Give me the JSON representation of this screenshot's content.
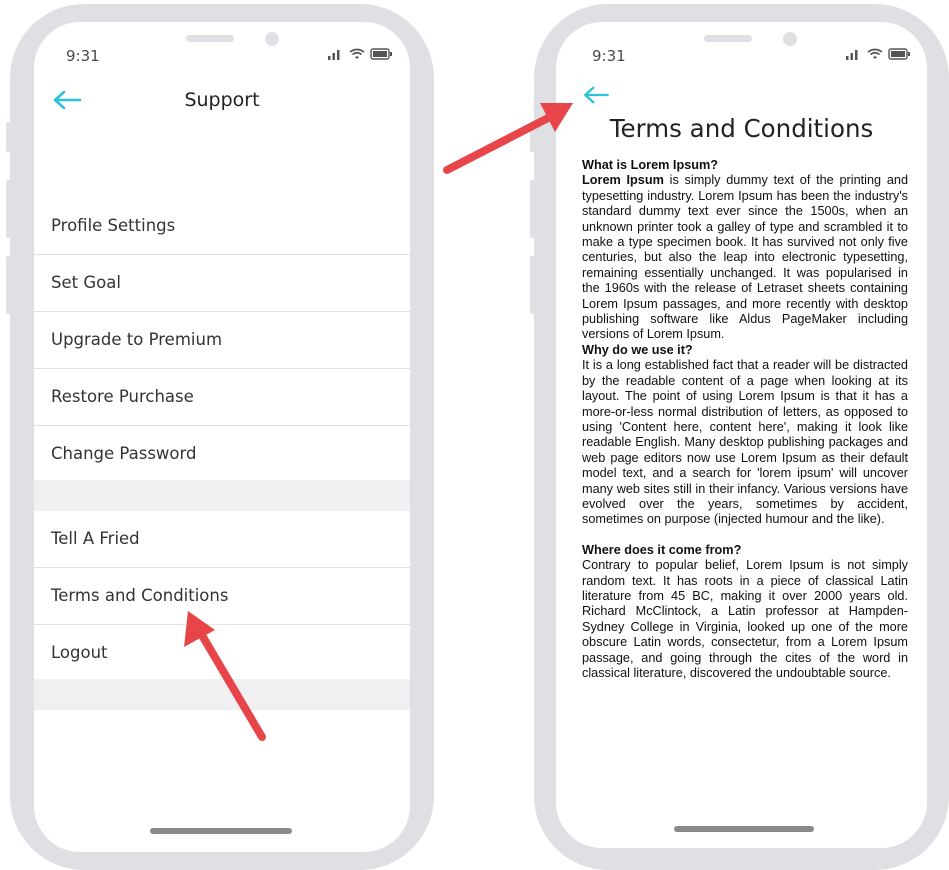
{
  "left_phone": {
    "status_time": "9:31",
    "header_title": "Support",
    "menu_group_1": [
      "Profile Settings",
      "Set Goal",
      "Upgrade to Premium",
      "Restore Purchase",
      "Change Password"
    ],
    "menu_group_2": [
      "Tell A Fried",
      "Terms and Conditions",
      "Logout"
    ]
  },
  "right_phone": {
    "status_time": "9:31",
    "title": "Terms and Conditions",
    "sections": [
      {
        "heading": "What is Lorem Ipsum?",
        "lead": "Lorem Ipsum",
        "body": " is simply dummy text of the printing and typesetting industry. Lorem Ipsum has been the industry's standard dummy text ever since the 1500s, when an unknown printer took a galley of type and scrambled it to make a type specimen book. It has survived not only five centuries, but also the leap into electronic typesetting, remaining essentially unchanged. It was popularised in the 1960s with the release of Letraset sheets containing Lorem Ipsum passages, and more recently with desktop publishing software like Aldus PageMaker including versions of Lorem Ipsum."
      },
      {
        "heading": "Why do we use it?",
        "body": "It is a long established fact that a reader will be distracted by the readable content of a page when looking at its layout. The point of using Lorem Ipsum is that it has a more-or-less normal distribution of letters, as opposed to using 'Content here, content here', making it look like readable English. Many desktop publishing packages and web page editors now use Lorem Ipsum as their default model text, and a search for 'lorem ipsum' will uncover many web sites still in their infancy. Various versions have evolved over the years, sometimes by accident, sometimes on purpose (injected humour and the like)."
      },
      {
        "heading": "Where does it come from?",
        "body": "Contrary to popular belief, Lorem Ipsum is not simply random text. It has roots in a piece of classical Latin literature from 45 BC, making it over 2000 years old. Richard McClintock, a Latin professor at Hampden-Sydney College in Virginia, looked up one of the more obscure Latin words, consectetur, from a Lorem Ipsum passage, and going through the cites of the word in classical literature, discovered the undoubtable source."
      }
    ]
  },
  "icons": {
    "back_arrow": "arrow-left-icon",
    "signal": "signal-icon",
    "wifi": "wifi-icon",
    "battery": "battery-icon",
    "annotation_arrow": "annotation-arrow-icon"
  },
  "colors": {
    "accent": "#29c4da",
    "phone_frame": "#dfe0e4",
    "annotation_arrow": "#e8454a",
    "divider_band": "#f0f0f2"
  }
}
